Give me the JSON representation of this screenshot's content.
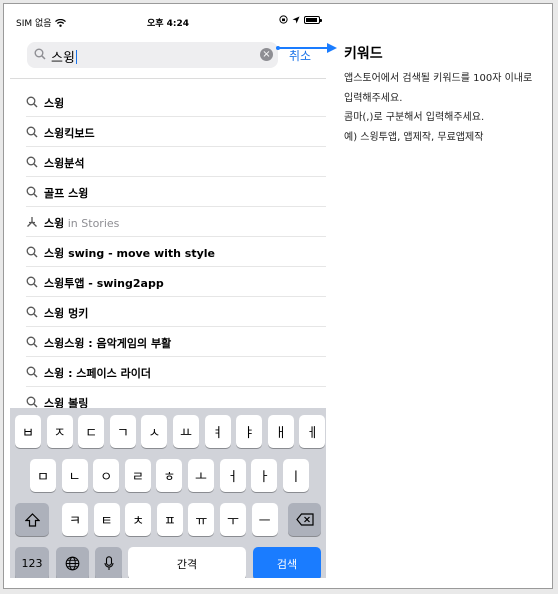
{
  "status_bar": {
    "carrier": "SIM 없음",
    "time": "오후 4:24"
  },
  "search": {
    "query": "스윙",
    "cancel_label": "취소"
  },
  "suggestions": [
    {
      "text": "스윙",
      "sub": "",
      "icon": "search-icon"
    },
    {
      "text": "스윙킥보드",
      "sub": "",
      "icon": "search-icon"
    },
    {
      "text": "스윙분석",
      "sub": "",
      "icon": "search-icon"
    },
    {
      "text": "골프 스윙",
      "sub": "",
      "icon": "search-icon"
    },
    {
      "text": "스윙",
      "sub": "in Stories",
      "icon": "app-store-icon"
    },
    {
      "text": "스윙 swing - move with style",
      "sub": "",
      "icon": "search-icon"
    },
    {
      "text": "스윙투앱 - swing2app",
      "sub": "",
      "icon": "search-icon"
    },
    {
      "text": "스윙 멍키",
      "sub": "",
      "icon": "search-icon"
    },
    {
      "text": "스윙스윙 : 음악게임의 부활",
      "sub": "",
      "icon": "search-icon"
    },
    {
      "text": "스윙 : 스페이스 라이더",
      "sub": "",
      "icon": "search-icon"
    },
    {
      "text": "스윙 볼링",
      "sub": "",
      "icon": "search-icon"
    }
  ],
  "keyboard": {
    "row1": [
      "ㅂ",
      "ㅈ",
      "ㄷ",
      "ㄱ",
      "ㅅ",
      "ㅛ",
      "ㅕ",
      "ㅑ",
      "ㅐ",
      "ㅔ"
    ],
    "row2": [
      "ㅁ",
      "ㄴ",
      "ㅇ",
      "ㄹ",
      "ㅎ",
      "ㅗ",
      "ㅓ",
      "ㅏ",
      "ㅣ"
    ],
    "row3": [
      "ㅋ",
      "ㅌ",
      "ㅊ",
      "ㅍ",
      "ㅠ",
      "ㅜ",
      "ㅡ"
    ],
    "numbers_label": "123",
    "space_label": "간격",
    "search_label": "검색"
  },
  "annotation": {
    "title": "키워드",
    "lines": [
      "앱스토어에서 검색될 키워드를 100자 이내로",
      "입력해주세요.",
      "콤마(,)로 구분해서 입력해주세요.",
      "예) 스윙투앱, 앱제작, 무료앱제작"
    ]
  },
  "colors": {
    "accent": "#1a7cff",
    "keyboard_bg": "#d1d3d9"
  }
}
